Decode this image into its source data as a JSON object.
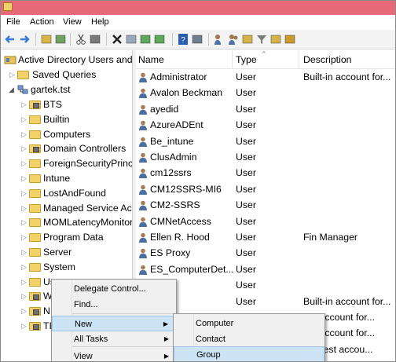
{
  "menubar": [
    "File",
    "Action",
    "View",
    "Help"
  ],
  "toolbar_icons": [
    "back-arrow-icon",
    "forward-arrow-icon",
    "up-folder-icon",
    "show-tree-icon",
    "cut-icon",
    "copy-icon",
    "delete-icon",
    "properties-icon",
    "refresh-icon",
    "export-list-icon",
    "help-icon",
    "show-action-pane-icon",
    "new-user-icon",
    "new-group-icon",
    "new-ou-icon",
    "filter-icon",
    "find-icon",
    "add-to-group-icon"
  ],
  "tree": {
    "root": "Active Directory Users and Computers",
    "saved_queries": "Saved Queries",
    "domain": "gartek.tst",
    "items": [
      {
        "label": "BTS",
        "type": "ou"
      },
      {
        "label": "Builtin",
        "type": "folder"
      },
      {
        "label": "Computers",
        "type": "folder"
      },
      {
        "label": "Domain Controllers",
        "type": "ou"
      },
      {
        "label": "ForeignSecurityPrincipals",
        "type": "folder"
      },
      {
        "label": "Intune",
        "type": "folder"
      },
      {
        "label": "LostAndFound",
        "type": "folder"
      },
      {
        "label": "Managed Service Accounts",
        "type": "folder"
      },
      {
        "label": "MOMLatencyMonitors",
        "type": "folder"
      },
      {
        "label": "Program Data",
        "type": "folder"
      },
      {
        "label": "Server",
        "type": "folder"
      },
      {
        "label": "System",
        "type": "folder"
      },
      {
        "label": "Users",
        "type": "folder"
      },
      {
        "label": "W",
        "type": "ou"
      },
      {
        "label": "N",
        "type": "ou"
      },
      {
        "label": "TI",
        "type": "ou"
      }
    ]
  },
  "list": {
    "headers": {
      "name": "Name",
      "type": "Type",
      "description": "Description"
    },
    "rows": [
      {
        "name": "Administrator",
        "type": "User",
        "description": "Built-in account for..."
      },
      {
        "name": "Avalon Beckman",
        "type": "User",
        "description": ""
      },
      {
        "name": "ayedid",
        "type": "User",
        "description": ""
      },
      {
        "name": "AzureADEnt",
        "type": "User",
        "description": ""
      },
      {
        "name": "Be_intune",
        "type": "User",
        "description": ""
      },
      {
        "name": "ClusAdmin",
        "type": "User",
        "description": ""
      },
      {
        "name": "cm12ssrs",
        "type": "User",
        "description": ""
      },
      {
        "name": "CM12SSRS-MI6",
        "type": "User",
        "description": ""
      },
      {
        "name": "CM2-SSRS",
        "type": "User",
        "description": ""
      },
      {
        "name": "CMNetAccess",
        "type": "User",
        "description": ""
      },
      {
        "name": "Ellen R. Hood",
        "type": "User",
        "description": "Fin Manager"
      },
      {
        "name": "ES Proxy",
        "type": "User",
        "description": ""
      },
      {
        "name": "ES_ComputerDet...",
        "type": "User",
        "description": ""
      },
      {
        "name": "",
        "type": "User",
        "description": ""
      },
      {
        "name": "",
        "type": "User",
        "description": "Built-in account for..."
      },
      {
        "name": "",
        "type": "",
        "description": "...n account for..."
      },
      {
        "name": "",
        "type": "",
        "description": "...n account for..."
      },
      {
        "name": "",
        "type": "",
        "description": "...'s test accou..."
      }
    ]
  },
  "context_menu": {
    "items": [
      "Delegate Control...",
      "Find...",
      "New",
      "All Tasks",
      "View"
    ]
  },
  "submenu": {
    "items": [
      "Computer",
      "Contact",
      "Group"
    ]
  }
}
